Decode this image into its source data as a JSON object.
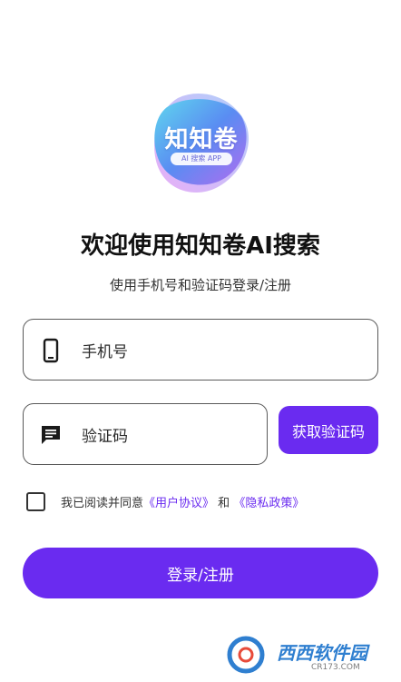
{
  "logo": {
    "title": "知知卷",
    "tagline": "AI 搜索 APP"
  },
  "welcome": {
    "title": "欢迎使用知知卷AI搜索",
    "subtitle": "使用手机号和验证码登录/注册"
  },
  "form": {
    "phone_placeholder": "手机号",
    "code_placeholder": "验证码",
    "get_code_label": "获取验证码"
  },
  "agreement": {
    "prefix": "我已阅读并同意",
    "user_agreement": "《用户协议》",
    "and": "和",
    "privacy_policy": "《隐私政策》",
    "checked": false
  },
  "login_button_label": "登录/注册",
  "watermark": {
    "text": "西西软件园",
    "sub": "CR173.COM"
  },
  "colors": {
    "accent": "#6a2bf0",
    "text": "#111111",
    "border": "#5a5a5a"
  }
}
